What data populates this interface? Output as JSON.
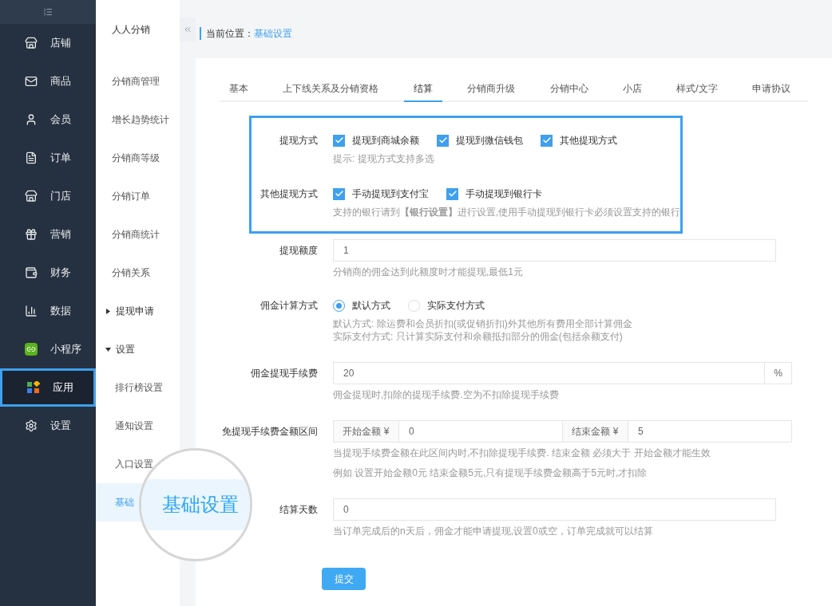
{
  "sidebar": {
    "items": [
      {
        "label": "店铺",
        "selected": false
      },
      {
        "label": "商品",
        "selected": false
      },
      {
        "label": "会员",
        "selected": false
      },
      {
        "label": "订单",
        "selected": false
      },
      {
        "label": "门店",
        "selected": false
      },
      {
        "label": "营销",
        "selected": false
      },
      {
        "label": "财务",
        "selected": false
      },
      {
        "label": "数据",
        "selected": false
      },
      {
        "label": "小程序",
        "selected": false
      },
      {
        "label": "应用",
        "selected": true
      },
      {
        "label": "设置",
        "selected": false
      }
    ]
  },
  "submenu": {
    "title": "人人分销",
    "items": [
      {
        "kind": "link",
        "label": "分销商管理",
        "selected": false
      },
      {
        "kind": "link",
        "label": "增长趋势统计",
        "selected": false
      },
      {
        "kind": "link",
        "label": "分销商等级",
        "selected": false
      },
      {
        "kind": "link",
        "label": "分销订单",
        "selected": false
      },
      {
        "kind": "link",
        "label": "分销商统计",
        "selected": false
      },
      {
        "kind": "link",
        "label": "分销关系",
        "selected": false
      },
      {
        "kind": "group",
        "label": "提现申请",
        "expanded": false
      },
      {
        "kind": "group",
        "label": "设置",
        "expanded": true,
        "children": [
          {
            "kind": "link",
            "label": "排行榜设置",
            "selected": false
          },
          {
            "kind": "link",
            "label": "通知设置",
            "selected": false
          },
          {
            "kind": "link",
            "label": "入口设置",
            "selected": false
          },
          {
            "kind": "link",
            "label": "基础",
            "selected": true
          }
        ]
      }
    ]
  },
  "magnifier": {
    "text": "基础设置"
  },
  "breadcrumb": {
    "label": "当前位置：",
    "current": "基础设置"
  },
  "tabs": [
    {
      "label": "基本",
      "selected": false
    },
    {
      "label": "上下线关系及分销资格",
      "selected": false
    },
    {
      "label": "结算",
      "selected": true
    },
    {
      "label": "分销商升级",
      "selected": false
    },
    {
      "label": "分销中心",
      "selected": false
    },
    {
      "label": "小店",
      "selected": false
    },
    {
      "label": "样式/文字",
      "selected": false
    },
    {
      "label": "申请协议",
      "selected": false
    }
  ],
  "sections": [
    {
      "highlighted": true,
      "fields": [
        {
          "kind": "checkboxes",
          "label": "提现方式",
          "options": [
            {
              "label": "提现到商城余额",
              "checked": true
            },
            {
              "label": "提现到微信钱包",
              "checked": true
            },
            {
              "label": "其他提现方式",
              "checked": true
            }
          ],
          "hints": [
            "提示: 提现方式支持多选"
          ]
        },
        {
          "kind": "checkboxes",
          "label": "其他提现方式",
          "options": [
            {
              "label": "手动提现到支付宝",
              "checked": true
            },
            {
              "label": "手动提现到银行卡",
              "checked": true
            }
          ],
          "hints": [
            "支持的银行请到**【银行设置】**进行设置,使用手动提现到银行卡必须设置支持的银行"
          ]
        }
      ]
    },
    {
      "highlighted": false,
      "fields": [
        {
          "kind": "input",
          "label": "提现额度",
          "value": "1",
          "hints": [
            "分销商的佣金达到此额度时才能提现,最低1元"
          ]
        },
        {
          "kind": "radios",
          "label": "佣金计算方式",
          "options": [
            {
              "label": "默认方式",
              "selected": true
            },
            {
              "label": "实际支付方式",
              "selected": false
            }
          ],
          "hints": [
            "默认方式: 除运费和会员折扣(或促销折扣)外其他所有费用全部计算佣金",
            "实际支付方式: 只计算实际支付和余额抵扣部分的佣金(包括余额支付)"
          ]
        },
        {
          "kind": "input_suffix",
          "label": "佣金提现手续费",
          "value": "20",
          "suffix": "%",
          "hints": [
            "佣金提现时,扣除的提现手续费.空为不扣除提现手续费"
          ]
        },
        {
          "kind": "range",
          "label": "免提现手续费金额区间",
          "start_prefix": "开始金额 ¥",
          "start_value": "0",
          "end_prefix": "结束金额 ¥",
          "end_value": "5",
          "hints": [
            "当提现手续费金额在此区间内时,不扣除提现手续费. 结束金额 必须大于 开始金额才能生效",
            "例如 设置开始金额0元 结束金额5元,只有提现手续费金额高于5元时,才扣除"
          ]
        },
        {
          "kind": "input",
          "label": "结算天数",
          "value": "0",
          "hints": [
            "当订单完成后的n天后，佣金才能申请提现,设置0或空，订单完成就可以结算"
          ]
        }
      ]
    }
  ],
  "submit": "提交"
}
